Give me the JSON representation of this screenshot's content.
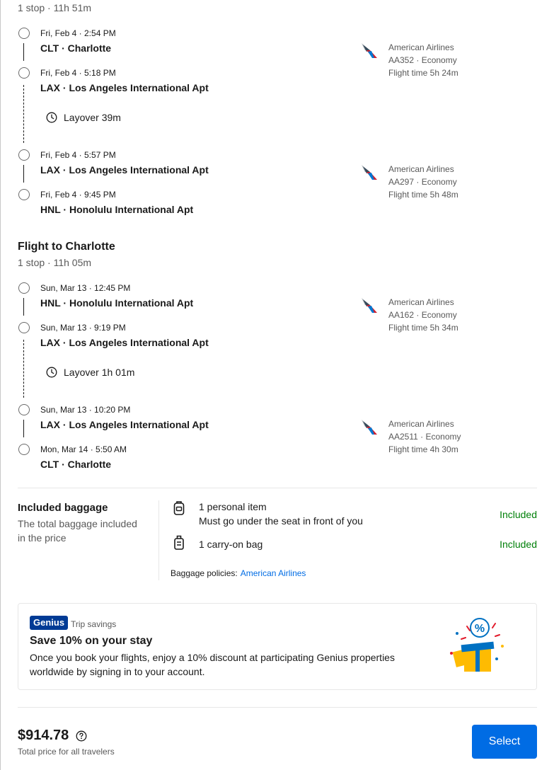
{
  "outbound": {
    "summary": "1 stop · 11h 51m",
    "legs": [
      {
        "depart_time": "Fri, Feb 4 · 2:54 PM",
        "depart_place": "CLT · Charlotte",
        "arrive_time": "Fri, Feb 4 · 5:18 PM",
        "arrive_place": "LAX · Los Angeles International Apt",
        "airline": "American Airlines",
        "flight": "AA352 · Economy",
        "duration": "Flight time 5h 24m"
      },
      {
        "depart_time": "Fri, Feb 4 · 5:57 PM",
        "depart_place": "LAX · Los Angeles International Apt",
        "arrive_time": "Fri, Feb 4 · 9:45 PM",
        "arrive_place": "HNL · Honolulu International Apt",
        "airline": "American Airlines",
        "flight": "AA297 · Economy",
        "duration": "Flight time 5h 48m"
      }
    ],
    "layover": "Layover 39m"
  },
  "return": {
    "title": "Flight to Charlotte",
    "summary": "1 stop · 11h 05m",
    "legs": [
      {
        "depart_time": "Sun, Mar 13 · 12:45 PM",
        "depart_place": "HNL · Honolulu International Apt",
        "arrive_time": "Sun, Mar 13 · 9:19 PM",
        "arrive_place": "LAX · Los Angeles International Apt",
        "airline": "American Airlines",
        "flight": "AA162 · Economy",
        "duration": "Flight time 5h 34m"
      },
      {
        "depart_time": "Sun, Mar 13 · 10:20 PM",
        "depart_place": "LAX · Los Angeles International Apt",
        "arrive_time": "Mon, Mar 14 · 5:50 AM",
        "arrive_place": "CLT · Charlotte",
        "airline": "American Airlines",
        "flight": "AA2511 · Economy",
        "duration": "Flight time 4h 30m"
      }
    ],
    "layover": "Layover 1h 01m"
  },
  "baggage": {
    "title": "Included baggage",
    "subtitle": "The total baggage included in the price",
    "items": [
      {
        "name": "1 personal item",
        "detail": "Must go under the seat in front of you",
        "status": "Included",
        "icon": "personal-item-icon"
      },
      {
        "name": "1 carry-on bag",
        "detail": "",
        "status": "Included",
        "icon": "carry-on-bag-icon"
      }
    ],
    "policy_label": "Baggage policies:",
    "policy_link": "American Airlines"
  },
  "genius": {
    "badge": "Genius",
    "tag": "Trip savings",
    "title": "Save 10% on your stay",
    "body": "Once you book your flights, enjoy a 10% discount at participating Genius properties worldwide by signing in to your account."
  },
  "footer": {
    "price": "$914.78",
    "price_note": "Total price for all travelers",
    "select_label": "Select"
  },
  "colors": {
    "included": "#008009",
    "link": "#006ce4",
    "button": "#006ce4",
    "genius_badge": "#003b95"
  }
}
